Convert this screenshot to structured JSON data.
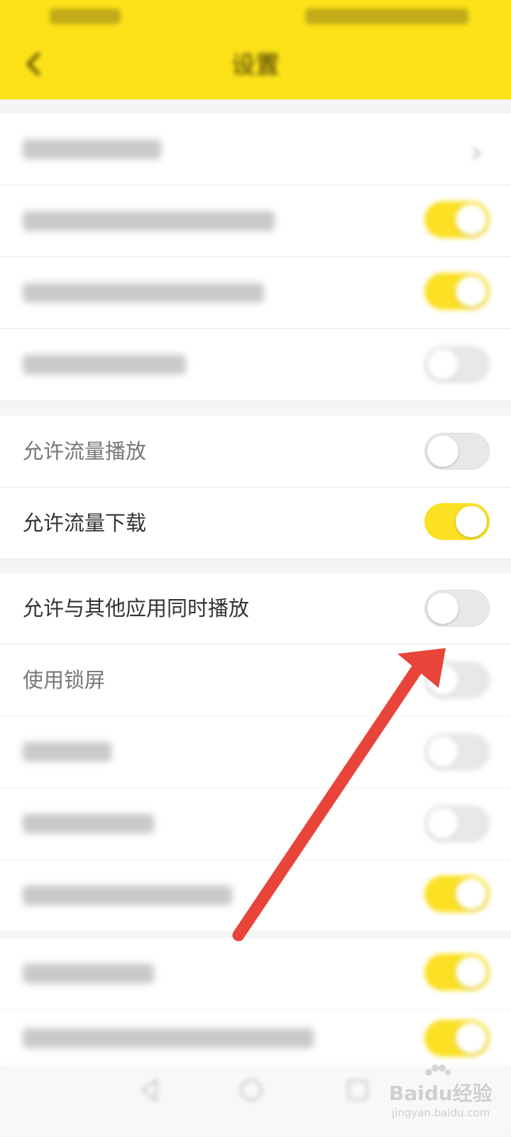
{
  "header": {
    "title": "设置"
  },
  "rows": {
    "allow_cellular_play": {
      "label": "允许流量播放",
      "on": false
    },
    "allow_cellular_download": {
      "label": "允许流量下载",
      "on": true
    },
    "allow_mix_playback": {
      "label": "允许与其他应用同时播放",
      "on": false
    },
    "use_lock_screen": {
      "label": "使用锁屏",
      "on": false
    }
  },
  "watermark": {
    "brand": "Baidu经验",
    "sub": "jingyan.baidu.com"
  },
  "colors": {
    "header_yellow": "#fde21a",
    "toggle_on": "#fbe024",
    "arrow_red": "#e8443a"
  }
}
